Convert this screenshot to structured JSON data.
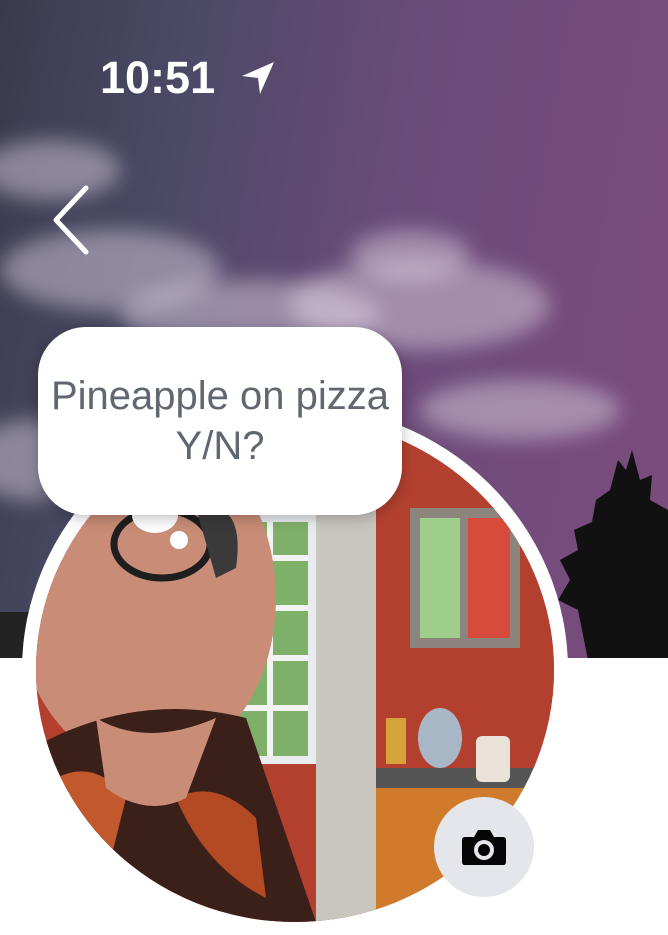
{
  "status_bar": {
    "time": "10:51",
    "location_icon": "location-arrow-icon"
  },
  "navigation": {
    "back_icon": "chevron-left-icon"
  },
  "profile": {
    "note_text": "Pineapple on pizza Y/N?",
    "camera_icon": "camera-icon"
  },
  "colors": {
    "note_text": "#606770",
    "camera_button_bg": "#e4e6eb",
    "cover_accent": "#7b4c7e"
  }
}
